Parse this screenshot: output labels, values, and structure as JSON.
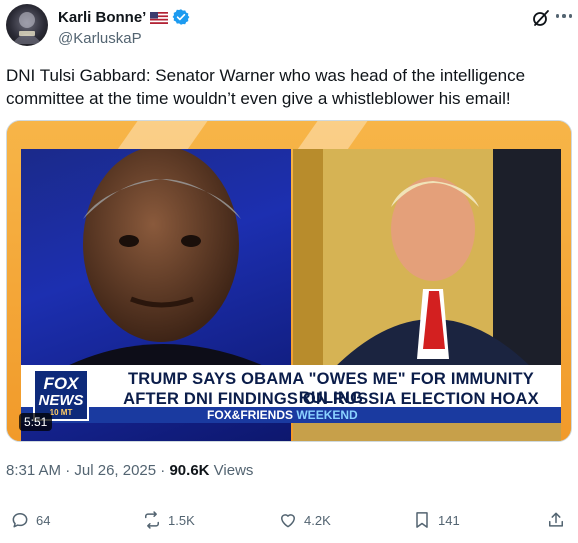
{
  "author": {
    "display_name": "Karli Bonne’",
    "handle": "@KarluskaP",
    "flag_icon": "us-flag-icon",
    "verified_color": "#1d9bf0"
  },
  "tweet": {
    "text": "DNI Tulsi Gabbard: Senator Warner who was head of the intelligence committee at the time wouldn’t even give a whistleblower his email!"
  },
  "video": {
    "duration": "5:51",
    "chyron_line1": "TRUMP SAYS OBAMA \"OWES ME\" FOR IMMUNITY RULING",
    "chyron_line2": "AFTER DNI FINDINGS ON RUSSIA ELECTION HOAX",
    "logo_top": "FOX",
    "logo_bottom": "NEWS",
    "logo_sub": "10 MT",
    "program_name": "FOX&FRIENDS",
    "program_suffix": "WEEKEND"
  },
  "meta": {
    "time": "8:31 AM",
    "separator": " · ",
    "date": "Jul 26, 2025",
    "views_count": "90.6K",
    "views_label": " Views"
  },
  "actions": {
    "replies": "64",
    "reposts": "1.5K",
    "likes": "4.2K",
    "bookmarks": "141"
  },
  "colors": {
    "text_primary": "#0f1419",
    "text_secondary": "#536471",
    "accent": "#1d9bf0",
    "fox_blue": "#0e2a7a",
    "banner_orange": "#f19a2a"
  }
}
